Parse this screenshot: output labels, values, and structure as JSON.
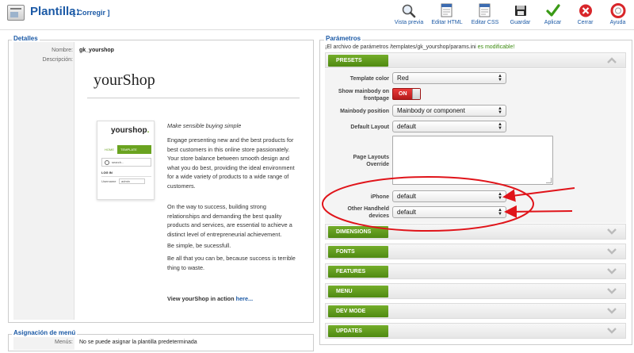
{
  "header": {
    "title": "Plantilla:",
    "subtitle": "[ Corregir ]",
    "toolbar": [
      {
        "label": "Vista previa",
        "icon": "magnifier-icon"
      },
      {
        "label": "Editar HTML",
        "icon": "html-file-icon"
      },
      {
        "label": "Editar CSS",
        "icon": "css-file-icon"
      },
      {
        "label": "Guardar",
        "icon": "save-icon"
      },
      {
        "label": "Aplicar",
        "icon": "checkmark-icon"
      },
      {
        "label": "Cerrar",
        "icon": "close-icon"
      },
      {
        "label": "Ayuda",
        "icon": "help-icon"
      }
    ]
  },
  "details": {
    "legend": "Detalles",
    "name_label": "Nombre:",
    "name_value": "gk_yourshop",
    "desc_label": "Descripción:",
    "brand": "yourShop",
    "thumbnail": {
      "logo": "yourshop",
      "logo_dot": ".",
      "nav": [
        "HOME",
        "TEMPLATE"
      ],
      "search": "search...",
      "login": "LOG IN",
      "username_label": "Username",
      "username_value": "admin"
    },
    "tagline": "Make sensible buying simple",
    "p1": "Engage presenting new and the best products for best customers in this online store passionately. Your store balance between smooth design and what you do best, providing the ideal environment for a wide variety of products to a wide range of customers.",
    "p2": "On the way to success, building strong relationships and demanding the best quality products and services, are essential to achieve a distinct level of entrepreneurial achievement.",
    "p3": "Be simple, be sucessfull.",
    "p4": "Be all that you can be, because success is terrible thing to waste.",
    "cta_text": "View yourShop in action",
    "cta_link": "here..."
  },
  "menu_assignment": {
    "legend": "Asignación de menú",
    "label": "Menús:",
    "value": "No se puede asignar la plantilla predeterminada"
  },
  "params": {
    "legend": "Parámetros",
    "file_info": "¡El archivo de parámetros /templates/gk_yourshop/params.ini",
    "file_status": "es modificable!",
    "presets_label": "PRESETS",
    "fields": {
      "template_color": {
        "label": "Template color",
        "value": "Red"
      },
      "show_mainbody": {
        "label": "Show mainbody on frontpage",
        "value": "ON"
      },
      "mainbody_position": {
        "label": "Mainbody position",
        "value": "Mainbody or component"
      },
      "default_layout": {
        "label": "Default Layout",
        "value": "default"
      },
      "page_layouts_override": {
        "label": "Page Layouts Override",
        "value": ""
      },
      "iphone": {
        "label": "iPhone",
        "value": "default"
      },
      "other_handheld": {
        "label": "Other Handheld devices",
        "value": "default"
      }
    },
    "sections": [
      "DIMENSIONS",
      "FONTS",
      "FEATURES",
      "MENU",
      "DEV MODE",
      "UPDATES"
    ]
  },
  "colors": {
    "accent_blue": "#1c5aa6",
    "section_green": "#5e9a1a",
    "toggle_red": "#d62828",
    "annotation_red": "#e0141a"
  }
}
